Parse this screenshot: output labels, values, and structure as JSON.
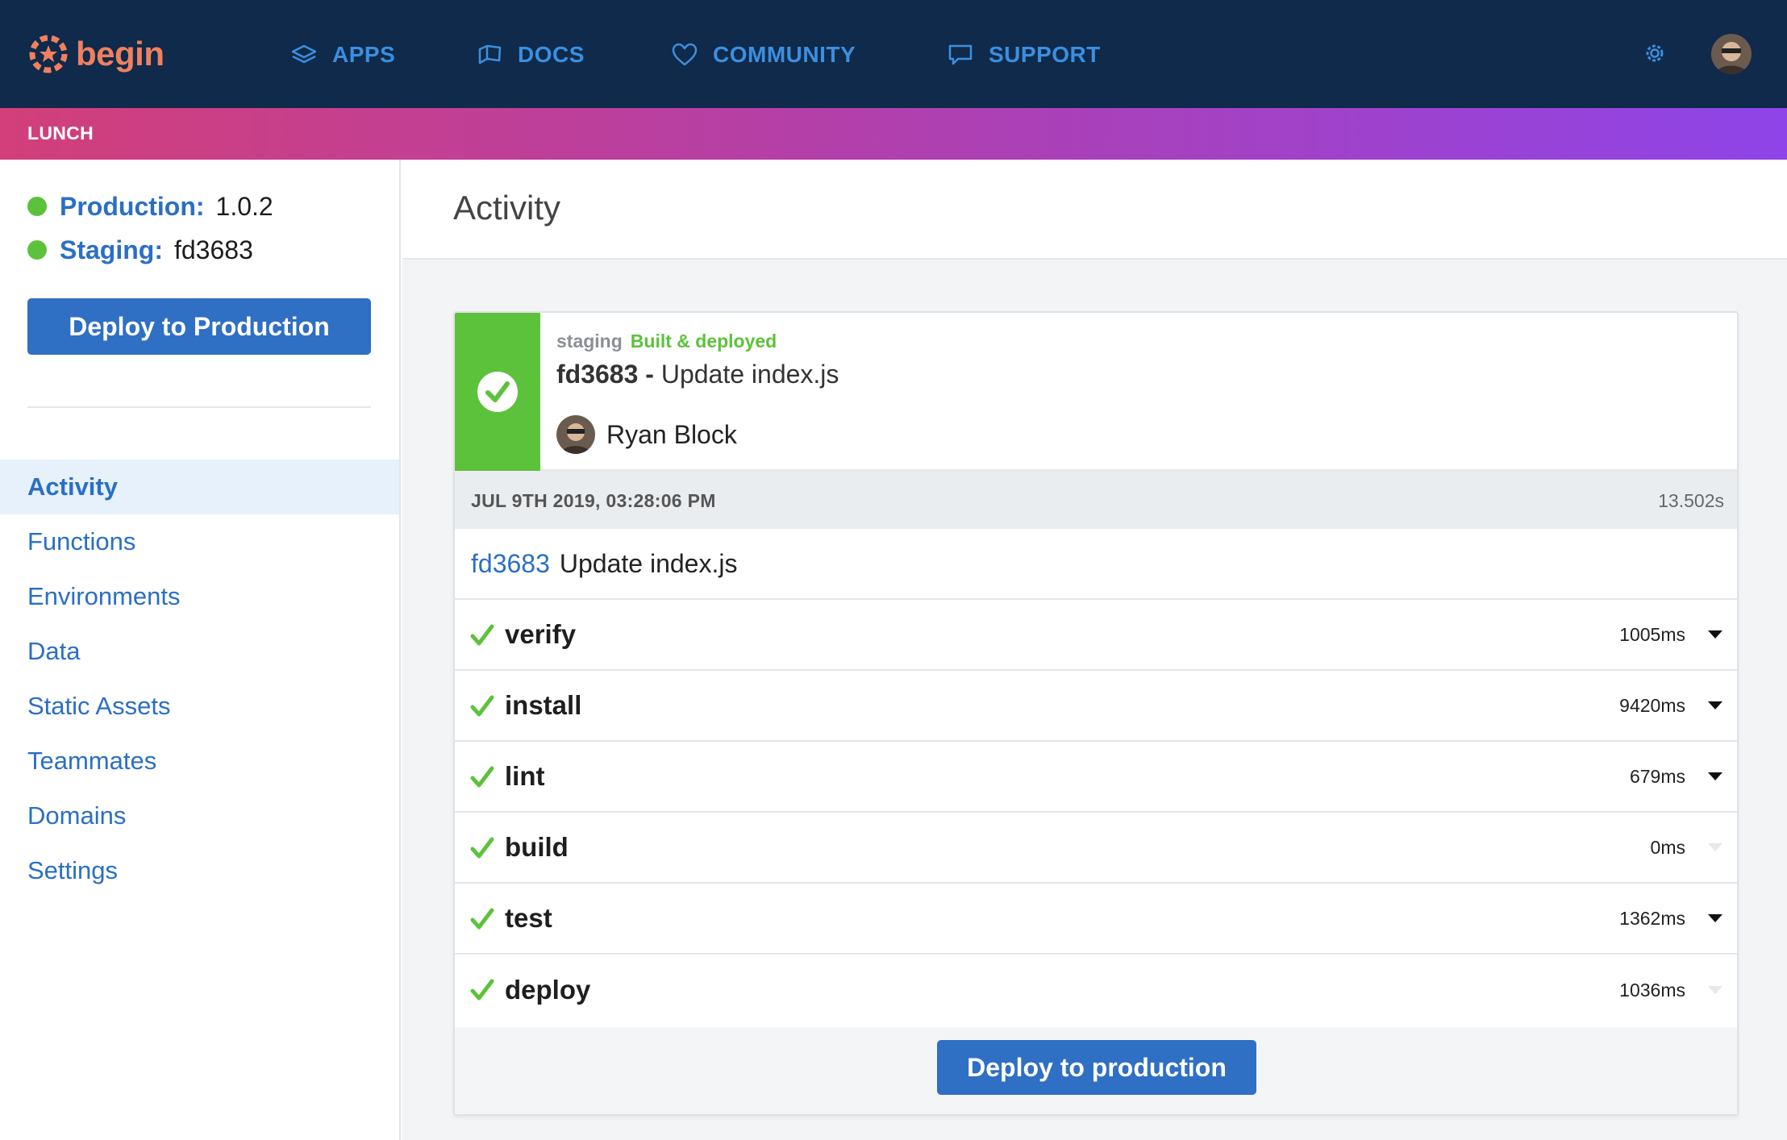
{
  "brand": {
    "name": "begin",
    "color": "#f0805f"
  },
  "nav": {
    "items": [
      {
        "label": "APPS",
        "icon": "layers-icon"
      },
      {
        "label": "DOCS",
        "icon": "book-icon"
      },
      {
        "label": "COMMUNITY",
        "icon": "heart-icon"
      },
      {
        "label": "SUPPORT",
        "icon": "chat-bubble-icon"
      }
    ],
    "settings_icon": "gear-icon"
  },
  "app": {
    "name": "LUNCH"
  },
  "environments": {
    "production": {
      "label": "Production:",
      "value": "1.0.2",
      "status_color": "#5cc23b"
    },
    "staging": {
      "label": "Staging:",
      "value": "fd3683",
      "status_color": "#5cc23b"
    }
  },
  "sidebar": {
    "deploy_button": "Deploy to Production",
    "items": [
      {
        "label": "Activity",
        "active": true
      },
      {
        "label": "Functions"
      },
      {
        "label": "Environments"
      },
      {
        "label": "Data"
      },
      {
        "label": "Static Assets"
      },
      {
        "label": "Teammates"
      },
      {
        "label": "Domains"
      },
      {
        "label": "Settings"
      }
    ]
  },
  "main": {
    "title": "Activity",
    "build": {
      "env": "staging",
      "status": "Built & deployed",
      "sha": "fd3683",
      "separator": "-",
      "message": "Update index.js",
      "author": "Ryan Block",
      "timestamp": "JUL 9TH 2019, 03:28:06 PM",
      "duration": "13.502s",
      "commit_sha": "fd3683",
      "commit_message": "Update index.js",
      "steps": [
        {
          "name": "verify",
          "time": "1005ms",
          "expandable": true
        },
        {
          "name": "install",
          "time": "9420ms",
          "expandable": true
        },
        {
          "name": "lint",
          "time": "679ms",
          "expandable": true
        },
        {
          "name": "build",
          "time": "0ms",
          "expandable": false
        },
        {
          "name": "test",
          "time": "1362ms",
          "expandable": true
        },
        {
          "name": "deploy",
          "time": "1036ms",
          "expandable": false
        }
      ],
      "deploy_button": "Deploy to production"
    }
  },
  "colors": {
    "nav_bg": "#0f2a4a",
    "accent": "#2f6fc4",
    "success": "#5cc23b"
  }
}
